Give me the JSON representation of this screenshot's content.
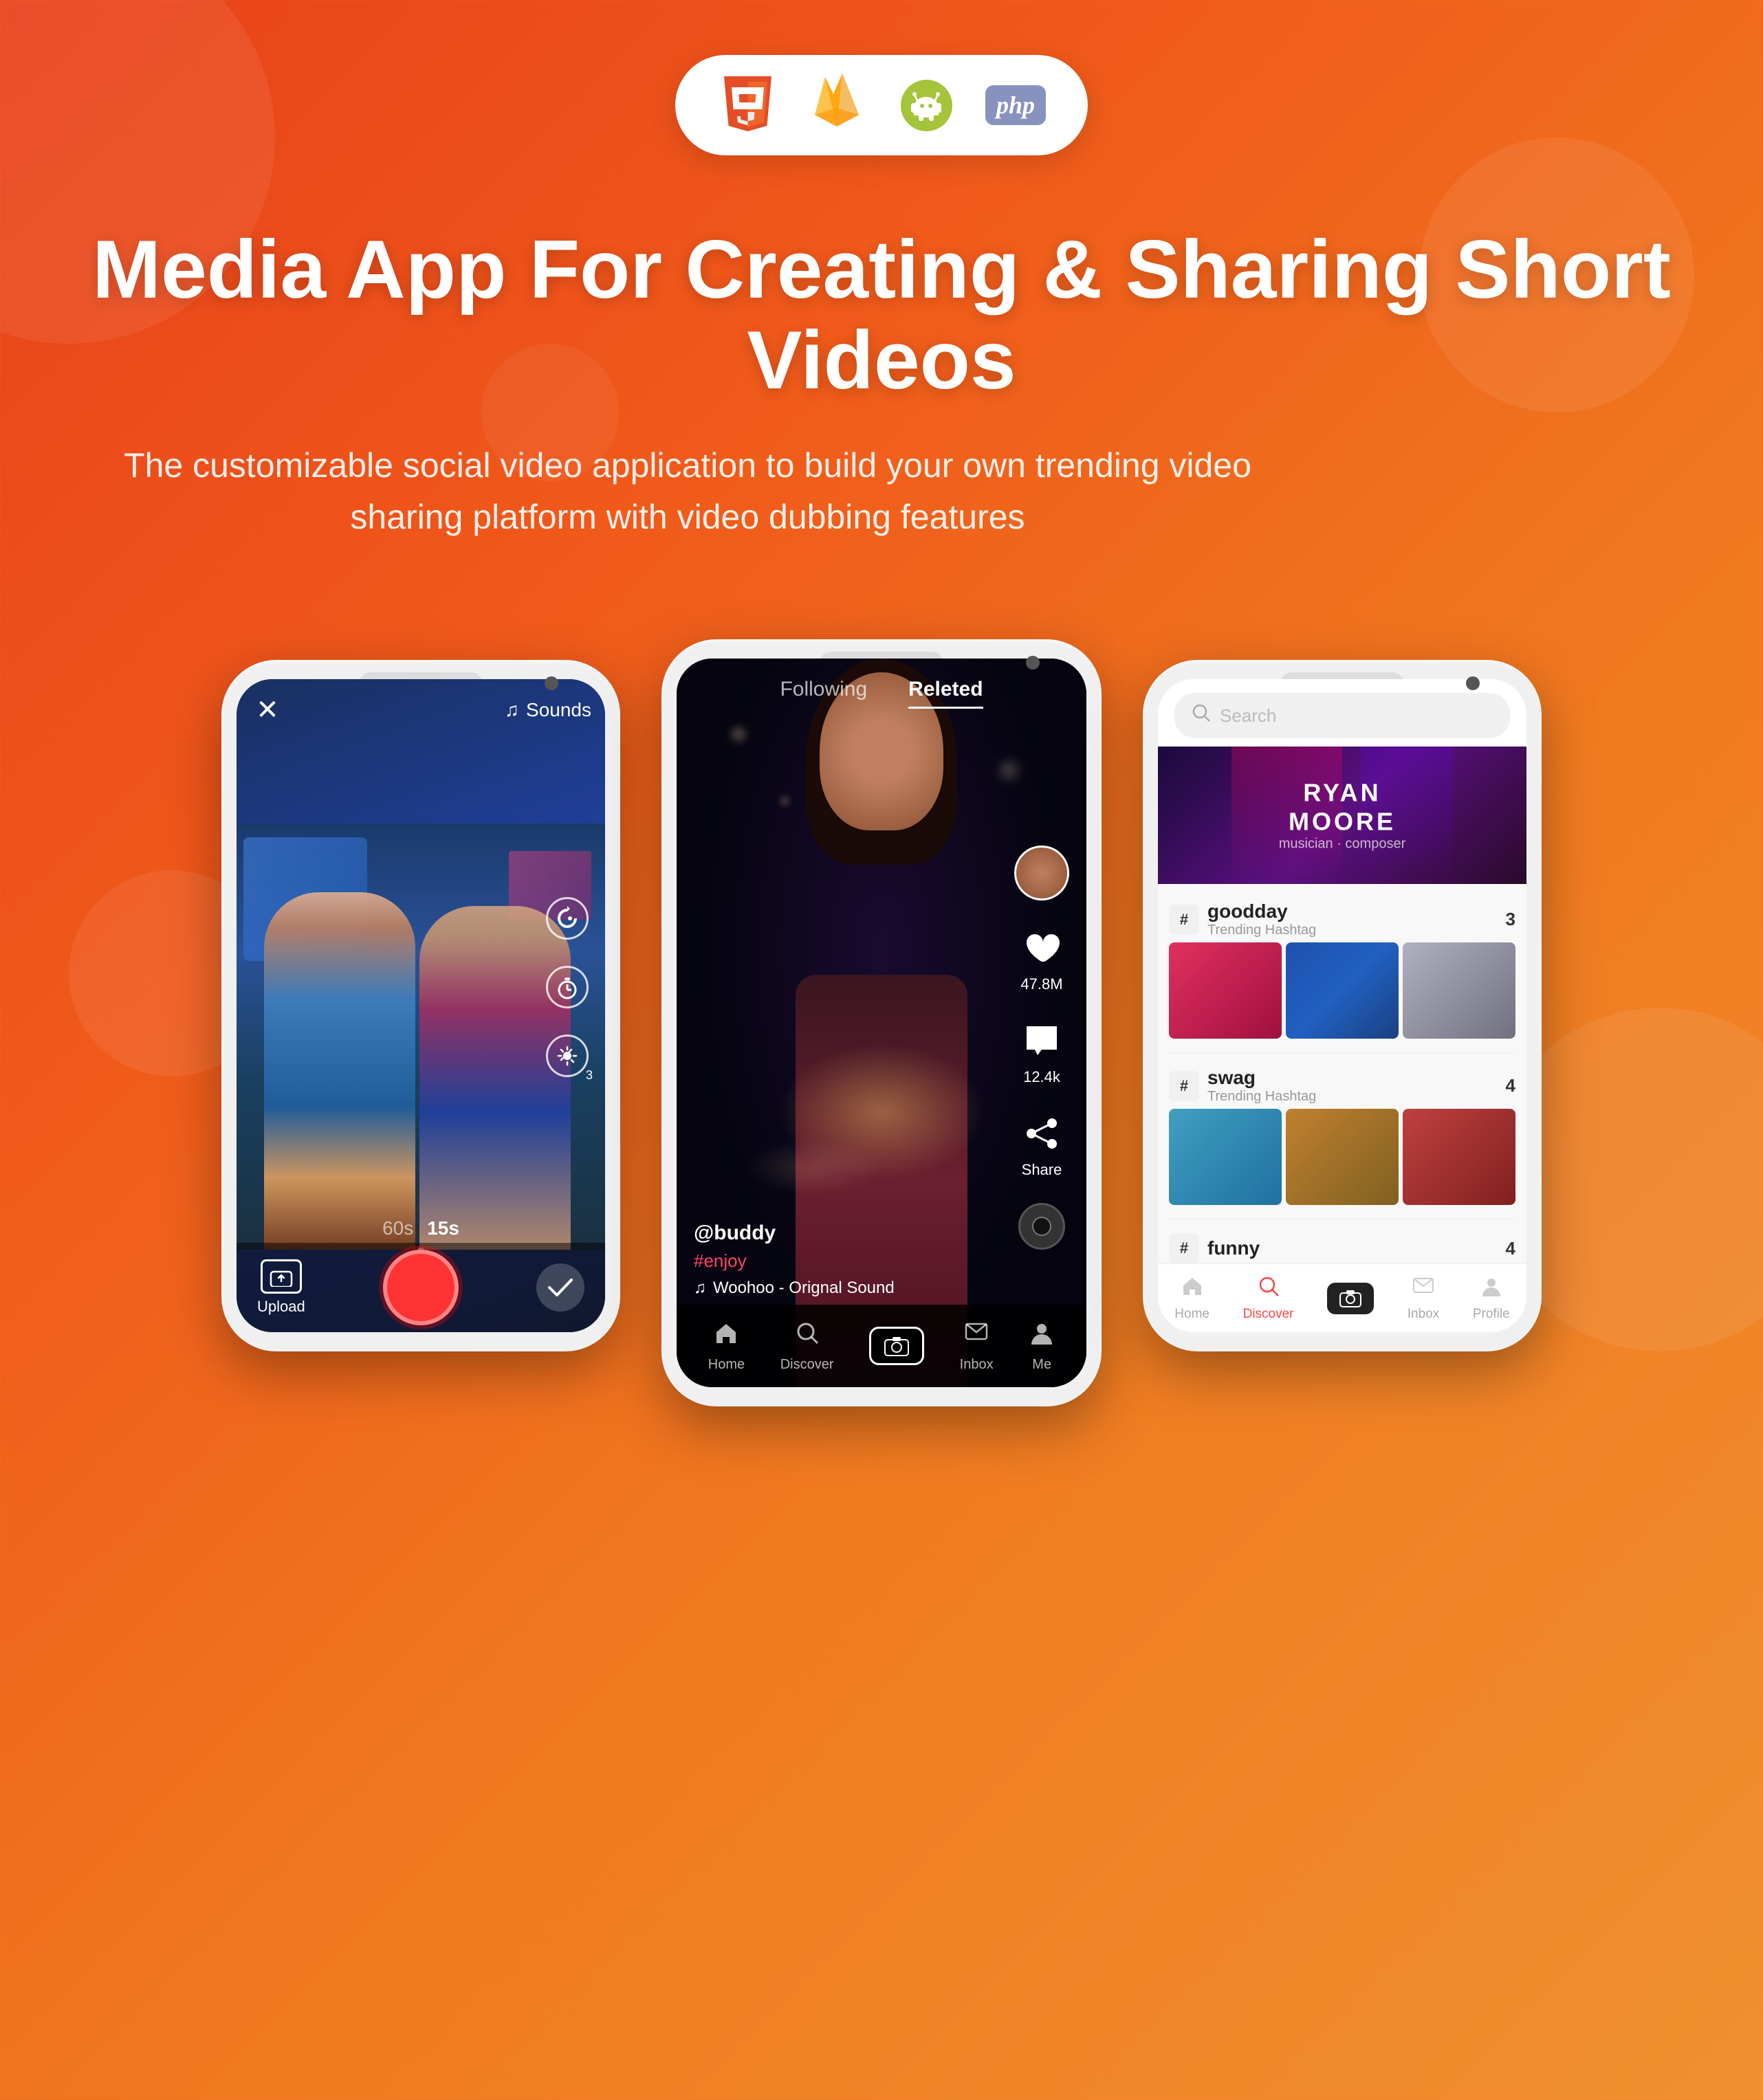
{
  "page": {
    "background_gradient": "linear-gradient(135deg, #e8401a 0%, #f05a1a 30%, #f07a20 60%, #f09030 100%)"
  },
  "tech_badge": {
    "icons": [
      {
        "name": "HTML5",
        "type": "html5"
      },
      {
        "name": "Firebase",
        "type": "firebase"
      },
      {
        "name": "Android",
        "type": "android"
      },
      {
        "name": "PHP",
        "type": "php"
      }
    ]
  },
  "hero": {
    "title": "Media App For Creating & Sharing Short Videos",
    "subtitle": "The customizable social video application to build your own trending video sharing platform with video dubbing features"
  },
  "phone_left": {
    "screen_type": "camera",
    "top_bar": {
      "close_label": "✕",
      "sounds_label": "Sounds",
      "music_icon": "♫"
    },
    "right_controls": [
      {
        "icon": "camera-flip",
        "label": ""
      },
      {
        "icon": "timer",
        "label": "3"
      },
      {
        "icon": "effects",
        "label": ""
      }
    ],
    "bottom": {
      "upload_label": "Upload",
      "timer_options": [
        "60s",
        "15s"
      ],
      "active_timer": "15s"
    }
  },
  "phone_middle": {
    "screen_type": "video_feed",
    "tabs": [
      {
        "label": "Following",
        "active": false
      },
      {
        "label": "Releted",
        "active": true
      }
    ],
    "video": {
      "username": "@buddy",
      "hashtag": "#enjoy",
      "sound": "Woohoo - Orignal Sound",
      "likes": "47.8M",
      "comments": "12.4k",
      "share_label": "Share"
    },
    "bottom_nav": [
      {
        "label": "Home",
        "icon": "home",
        "active": false
      },
      {
        "label": "Discover",
        "icon": "search",
        "active": false
      },
      {
        "label": "",
        "icon": "camera",
        "active": false,
        "is_center": true
      },
      {
        "label": "Inbox",
        "icon": "inbox",
        "active": false
      },
      {
        "label": "Me",
        "icon": "person",
        "active": false
      }
    ]
  },
  "phone_right": {
    "screen_type": "discover",
    "search": {
      "placeholder": "Search",
      "icon": "search"
    },
    "banner": {
      "name": "RYAN MOORE",
      "subtitle": "musician · composer"
    },
    "hashtags": [
      {
        "tag": "goodday",
        "subtitle": "Trending Hashtag",
        "count": "3",
        "images": [
          "img1",
          "img2",
          "img3"
        ]
      },
      {
        "tag": "swag",
        "subtitle": "Trending Hashtag",
        "count": "4",
        "images": [
          "img4",
          "img5",
          "img6"
        ]
      },
      {
        "tag": "funny",
        "subtitle": "",
        "count": "4",
        "images": []
      }
    ],
    "bottom_nav": [
      {
        "label": "Home",
        "icon": "home",
        "active": false
      },
      {
        "label": "Discover",
        "icon": "search",
        "active": true
      },
      {
        "label": "",
        "icon": "camera",
        "active": false,
        "is_center": true
      },
      {
        "label": "Inbox",
        "icon": "inbox",
        "active": false
      },
      {
        "label": "Profile",
        "icon": "person",
        "active": false
      }
    ]
  }
}
